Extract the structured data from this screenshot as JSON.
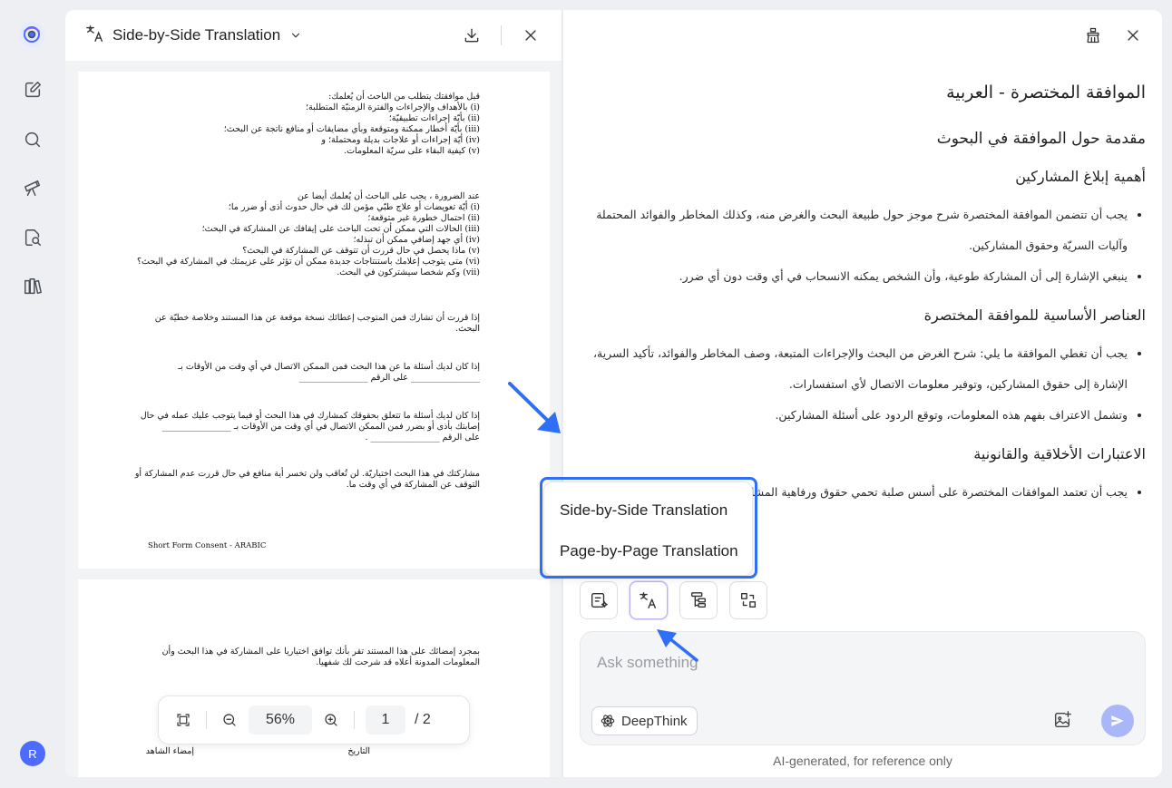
{
  "sidebar": {
    "items": [
      {
        "icon": "new-chat-icon"
      },
      {
        "icon": "search-icon"
      },
      {
        "icon": "telescope-icon"
      },
      {
        "icon": "doc-search-icon"
      },
      {
        "icon": "library-icon"
      }
    ],
    "user_initial": "R"
  },
  "doc_panel": {
    "title": "Side-by-Side Translation",
    "zoom": "56%",
    "page": "1",
    "page_total": "/ 2"
  },
  "document": {
    "page1_blocks": [
      {
        "lines": [
          "قبل موافقتك يتطلب من الباحث أن يُعلمك:",
          "(i) بالأهداف والإجراءات والفترة الزمنيّة المتطلبة؛",
          "(ii) بأيّة إجراءات تطبيقيّة؛",
          "(iii) بأيّة أخطار ممكنة ومتوقعة وبأي مضايقات أو منافع ناتجة عن البحث؛",
          "(iv) أيّة إجراءات أو علاجات بديلة ومحتملة؛ و",
          "(v) كيفية البقاء على سريّة المعلومات."
        ]
      },
      {
        "lines": [
          "عند الضرورة ، يجب على الباحث أن يُعلمك أيضا عن",
          "(i) أيّة تعويضات أو علاج طبّي مؤمن لك في حال حدوث أذى أو ضرر ما؛",
          "(ii) احتمال خطورة غير متوقعة؛",
          "(iii) الحالات التي ممكن أن تحت الباحث على إيقافك عن المشاركة في البحث؛",
          "(iv) أي جهد إضافي ممكن أن تبذله؛",
          "(v) ماذا يحصل في حال قررت أن تتوقف عن المشاركة في البحث؟",
          "(vi) متى يتوجب إعلامك باستنتاجات جديدة ممكن أن تؤثر على عزيمتك في المشاركة في البحث؟",
          "(vii) وكم شخصا سيشتركون في البحث."
        ]
      },
      {
        "lines": [
          "إذا قررت أن تشارك فمن المتوجب إعطائك نسخة موقعة عن هذا المستند وخلاصة خطيّة عن",
          "البحث."
        ]
      },
      {
        "lines": [
          "إذا كان لديك أسئلة ما عن هذا البحث فمن الممكن الاتصال في أي وقت من الأوقات بـ",
          "________________ على الرقم ________________"
        ]
      },
      {
        "lines": [
          "إذا كان لديك أسئلة ما تتعلق بحقوقك كمشارك في هذا البحث أو فيما يتوجب عليك عمله في حال",
          "إصابتك بأذى أو بضرر فمن الممكن الاتصال في أي وقت من الأوقات بـ ________________",
          "على الرقم ________________ ."
        ]
      },
      {
        "lines": [
          "مشاركتك في هذا البحث اختياريّة. لن تُعاقب ولن تخسر أية منافع في حال قررت عدم المشاركة أو",
          "التوقف عن المشاركة في أي وقت ما."
        ]
      }
    ],
    "page1_footer": "Short Form Consent - ARABIC",
    "page2_blocks": [
      {
        "lines": [
          "بمجرد إمضائك على هذا المستند تقر بأنك توافق اختياريا على المشاركة في هذا البحث وأن",
          "المعلومات المدونة أعلاه قد شرحت لك شفهيا."
        ]
      }
    ],
    "page2_sig": {
      "left": "إمضاء الشاهد",
      "right": "التاريخ"
    }
  },
  "translation": {
    "title": "الموافقة المختصرة - العربية",
    "subtitle": "مقدمة حول الموافقة في البحوث",
    "sections": [
      {
        "heading": "أهمية إبلاغ المشاركين",
        "bullets": [
          "يجب أن تتضمن الموافقة المختصرة شرح موجز حول طبيعة البحث والغرض منه، وكذلك المخاطر والفوائد المحتملة وآليات السريّة وحقوق المشاركين.",
          "ينبغي الإشارة إلى أن المشاركة طوعية، وأن الشخص يمكنه الانسحاب في أي وقت دون أي ضرر."
        ]
      },
      {
        "heading": "العناصر الأساسية للموافقة المختصرة",
        "bullets": [
          "يجب أن تغطي الموافقة ما يلي: شرح الغرض من البحث والإجراءات المتبعة، وصف المخاطر والفوائد، تأكيد السرية، الإشارة إلى حقوق المشاركين، وتوفير معلومات الاتصال لأي استفسارات.",
          "وتشمل الاعتراف بفهم هذه المعلومات، وتوقع الردود على أسئلة المشاركين."
        ]
      },
      {
        "heading": "الاعتبارات الأخلاقية والقانونية",
        "bullets": [
          "يجب أن تعتمد الموافقات المختصرة على أسس صلبة تحمي حقوق ورفاهية المشاركين."
        ]
      }
    ]
  },
  "popup": {
    "items": [
      "Side-by-Side Translation",
      "Page-by-Page Translation"
    ]
  },
  "toolbar": {
    "tools": [
      "summary-icon",
      "translate-icon",
      "outline-icon",
      "convert-icon"
    ]
  },
  "composer": {
    "placeholder": "Ask something",
    "deepthink_label": "DeepThink"
  },
  "disclaimer": "AI-generated, for reference only",
  "colors": {
    "accent": "#2f6ef6",
    "brand": "#4d6bfe",
    "send_disabled": "#a9b7f8"
  }
}
